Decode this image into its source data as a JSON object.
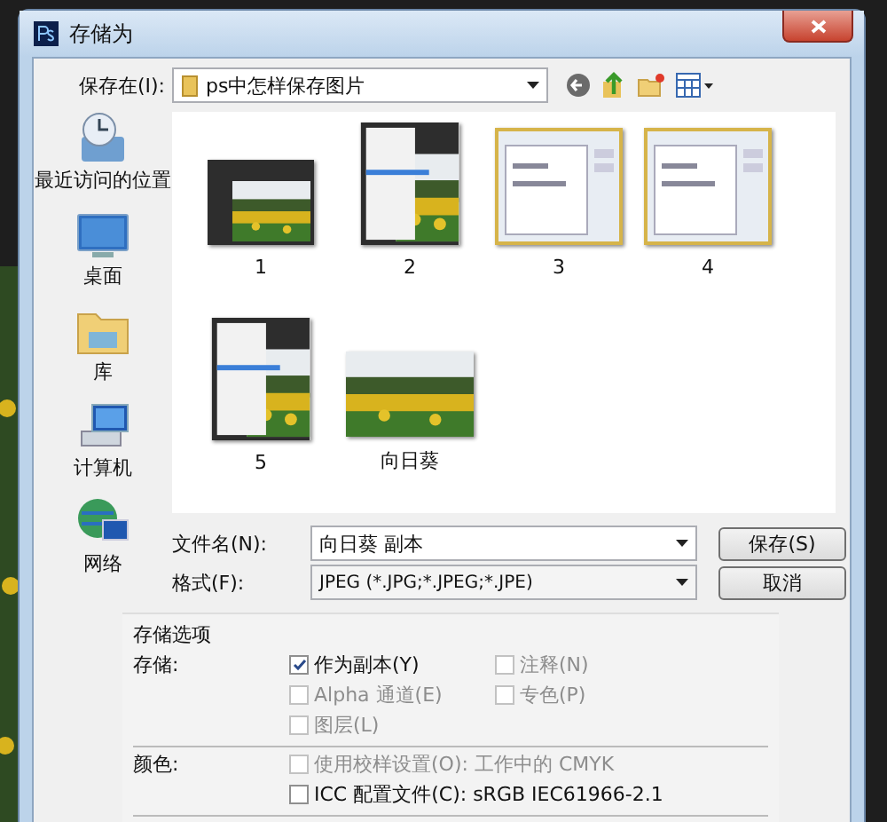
{
  "window": {
    "title": "存储为"
  },
  "save_in": {
    "label": "保存在(I):",
    "value": "ps中怎样保存图片"
  },
  "places": [
    {
      "kind": "recent",
      "label": "最近访问的位置"
    },
    {
      "kind": "desktop",
      "label": "桌面"
    },
    {
      "kind": "library",
      "label": "库"
    },
    {
      "kind": "computer",
      "label": "计算机"
    },
    {
      "kind": "network",
      "label": "网络"
    }
  ],
  "files": [
    {
      "kind": "editor",
      "label": "1"
    },
    {
      "kind": "menu",
      "label": "2"
    },
    {
      "kind": "dialog",
      "label": "3"
    },
    {
      "kind": "dialog",
      "label": "4"
    },
    {
      "kind": "menu",
      "label": "5"
    },
    {
      "label": "向日葵"
    }
  ],
  "file_name": {
    "label": "文件名(N):",
    "value": "向日葵 副本"
  },
  "format": {
    "label": "格式(F):",
    "value": "JPEG (*.JPG;*.JPEG;*.JPE)"
  },
  "buttons": [
    "保存(S)",
    "取消"
  ],
  "options": {
    "title": "存储选项",
    "groups": [
      {
        "label": "存储:",
        "items": [
          {
            "label": "作为副本(Y)",
            "checked": true,
            "disabled": false
          },
          {
            "label": "注释(N)",
            "checked": false,
            "disabled": true
          },
          {
            "label": "Alpha 通道(E)",
            "checked": false,
            "disabled": true
          },
          {
            "label": "专色(P)",
            "checked": false,
            "disabled": true
          },
          {
            "label": "图层(L)",
            "checked": false,
            "disabled": true
          }
        ]
      },
      {
        "label": "颜色:",
        "items": [
          {
            "label": "使用校样设置(O):  工作中的 CMYK",
            "checked": false,
            "disabled": true
          },
          {
            "label": "ICC 配置文件(C):  sRGB IEC61966-2.1",
            "checked": false,
            "disabled": false
          }
        ]
      }
    ]
  }
}
